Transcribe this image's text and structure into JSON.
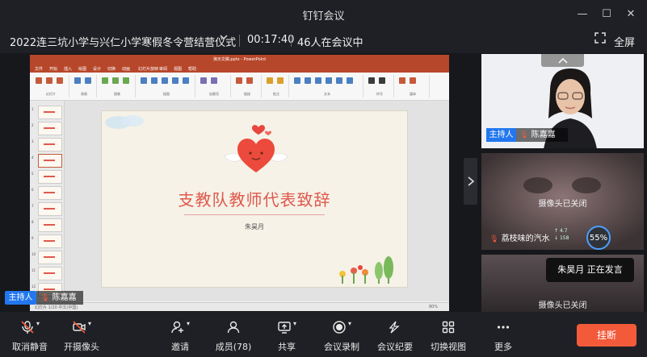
{
  "window": {
    "title": "钉钉会议",
    "minimize": "—",
    "maximize": "☐",
    "close": "✕"
  },
  "meeting": {
    "name": "2022连三坑小学与兴仁小学寒假冬令营结营仪式",
    "elapsed": "00:17:40",
    "participants_line": "46人在会议中",
    "fullscreen_label": "全屏"
  },
  "shared_screen": {
    "app": "PowerPoint",
    "file_label": "演示文稿.pptx - PowerPoint",
    "tabs": [
      "文件",
      "开始",
      "插入",
      "绘图",
      "设计",
      "切换",
      "动画",
      "幻灯片放映",
      "审阅",
      "视图",
      "帮助"
    ],
    "ribbon_groups": [
      "幻灯片",
      "表格",
      "图像",
      "插图",
      "加载项",
      "链接",
      "批注",
      "文本",
      "符号",
      "媒体"
    ],
    "slide": {
      "title": "支教队教师代表致辞",
      "author": "朱昊月"
    },
    "status_text": "幻灯片 1/20  中文(中国)",
    "zoom": "80%",
    "thumb_count": 12
  },
  "share_host_tag": {
    "role": "主持人",
    "name": "陈嘉嘉"
  },
  "participants": [
    {
      "role": "主持人",
      "name": "陈嘉嘉",
      "camera": "on"
    },
    {
      "name": "荔枝味的汽水",
      "camera_status": "摄像头已关闭",
      "net_up": "4.7",
      "net_down": "158",
      "volume": "55%"
    },
    {
      "camera_status": "摄像头已关闭"
    }
  ],
  "speaking_toast": {
    "speaker": "朱昊月",
    "status": "正在发言"
  },
  "toolbar": [
    {
      "label": "取消静音",
      "icon": "mic-muted-icon"
    },
    {
      "label": "开摄像头",
      "icon": "camera-off-icon"
    },
    {
      "label": "邀请",
      "icon": "add-user-icon"
    },
    {
      "label": "成员(78)",
      "icon": "members-icon"
    },
    {
      "label": "共享",
      "icon": "share-screen-icon"
    },
    {
      "label": "会议录制",
      "icon": "record-icon"
    },
    {
      "label": "会议纪要",
      "icon": "minutes-icon"
    },
    {
      "label": "切换视图",
      "icon": "grid-view-icon"
    },
    {
      "label": "更多",
      "icon": "more-icon"
    }
  ],
  "hangup_label": "挂断",
  "colors": {
    "accent_blue": "#2277ee",
    "hangup_red": "#f35a3a",
    "ppt_brand": "#b7472a",
    "slide_title": "#e0584d"
  }
}
